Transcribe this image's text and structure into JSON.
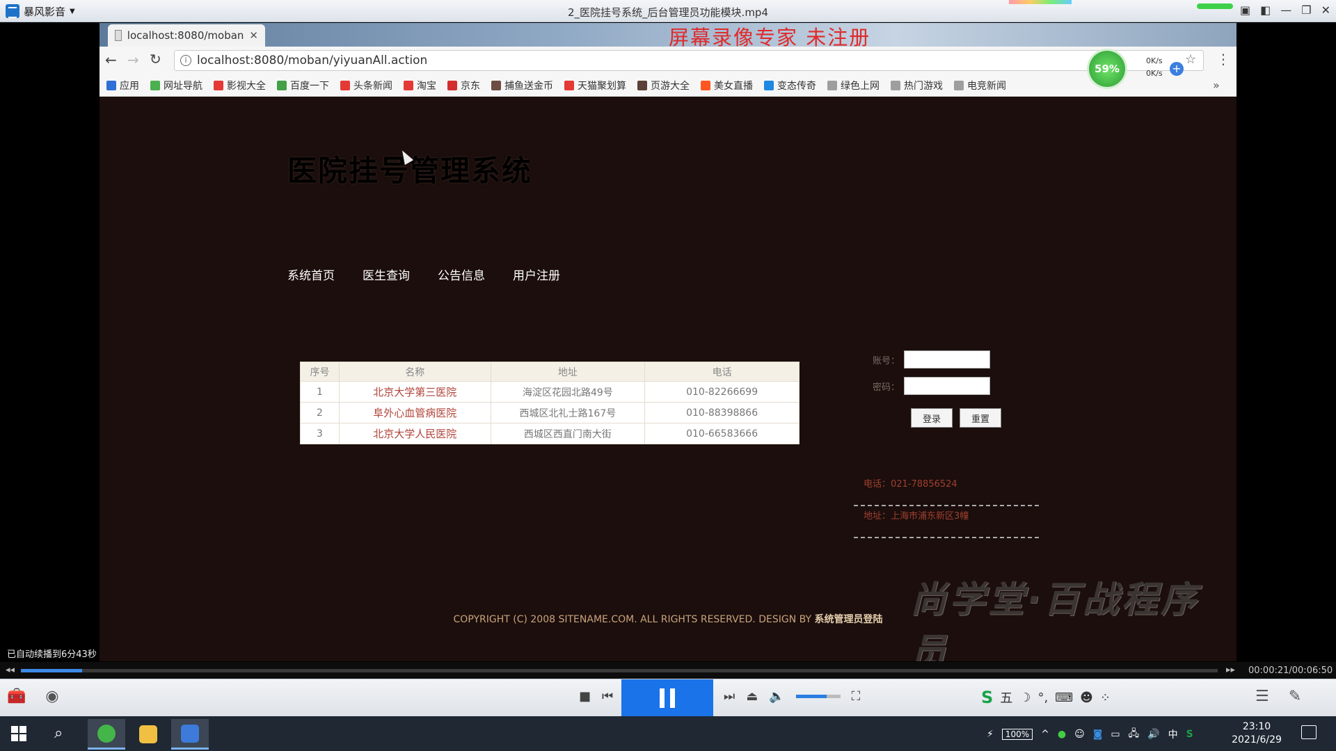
{
  "player": {
    "app_name": "暴风影音",
    "title": "2_医院挂号系统_后台管理员功能模块.mp4",
    "autoplay_note": "已自动续播到6分43秒",
    "time": "00:00:21/00:06:50",
    "progress_fraction": 0.051
  },
  "recorder_watermark": "屏幕录像专家 未注册",
  "browser": {
    "tab_title": "localhost:8080/moban",
    "url": "localhost:8080/moban/yiyuanAll.action",
    "bookmarks": [
      {
        "label": "应用",
        "color": "#2f6fd6"
      },
      {
        "label": "网址导航",
        "color": "#4caf50"
      },
      {
        "label": "影视大全",
        "color": "#e53935"
      },
      {
        "label": "百度一下",
        "color": "#43a047"
      },
      {
        "label": "头条新闻",
        "color": "#e53935"
      },
      {
        "label": "淘宝",
        "color": "#e53935"
      },
      {
        "label": "京东",
        "color": "#d32f2f"
      },
      {
        "label": "捕鱼送金币",
        "color": "#6d4c41"
      },
      {
        "label": "天猫聚划算",
        "color": "#e53935"
      },
      {
        "label": "页游大全",
        "color": "#5d4037"
      },
      {
        "label": "美女直播",
        "color": "#ff5722"
      },
      {
        "label": "变态传奇",
        "color": "#1e88e5"
      },
      {
        "label": "绿色上网",
        "color": "#9e9e9e"
      },
      {
        "label": "热门游戏",
        "color": "#9e9e9e"
      },
      {
        "label": "电竞新闻",
        "color": "#9e9e9e"
      }
    ],
    "speed_percent": "59%",
    "speed_up": "0K/s",
    "speed_down": "0K/s"
  },
  "site": {
    "title": "医院挂号管理系统",
    "nav": [
      "系统首页",
      "医生查询",
      "公告信息",
      "用户注册"
    ],
    "table": {
      "headers": [
        "序号",
        "名称",
        "地址",
        "电话"
      ],
      "rows": [
        [
          "1",
          "北京大学第三医院",
          "海淀区花园北路49号",
          "010-82266699"
        ],
        [
          "2",
          "阜外心血管病医院",
          "西城区北礼士路167号",
          "010-88398866"
        ],
        [
          "3",
          "北京大学人民医院",
          "西城区西直门南大街",
          "010-66583666"
        ]
      ]
    },
    "login": {
      "account_label": "账号：",
      "password_label": "密码：",
      "login_button": "登录",
      "reset_button": "重置"
    },
    "contact": {
      "phone": "电话：021-78856524",
      "address": "地址：上海市浦东新区3幢"
    },
    "brand": "尚学堂·百战程序员",
    "copyright_text": "COPYRIGHT (C) 2008 SITENAME.COM. ALL RIGHTS RESERVED. DESIGN BY ",
    "copyright_link": "系统管理员登陆"
  },
  "taskbar": {
    "battery": "100%",
    "ime": "中",
    "time": "23:10",
    "date": "2021/6/29"
  }
}
